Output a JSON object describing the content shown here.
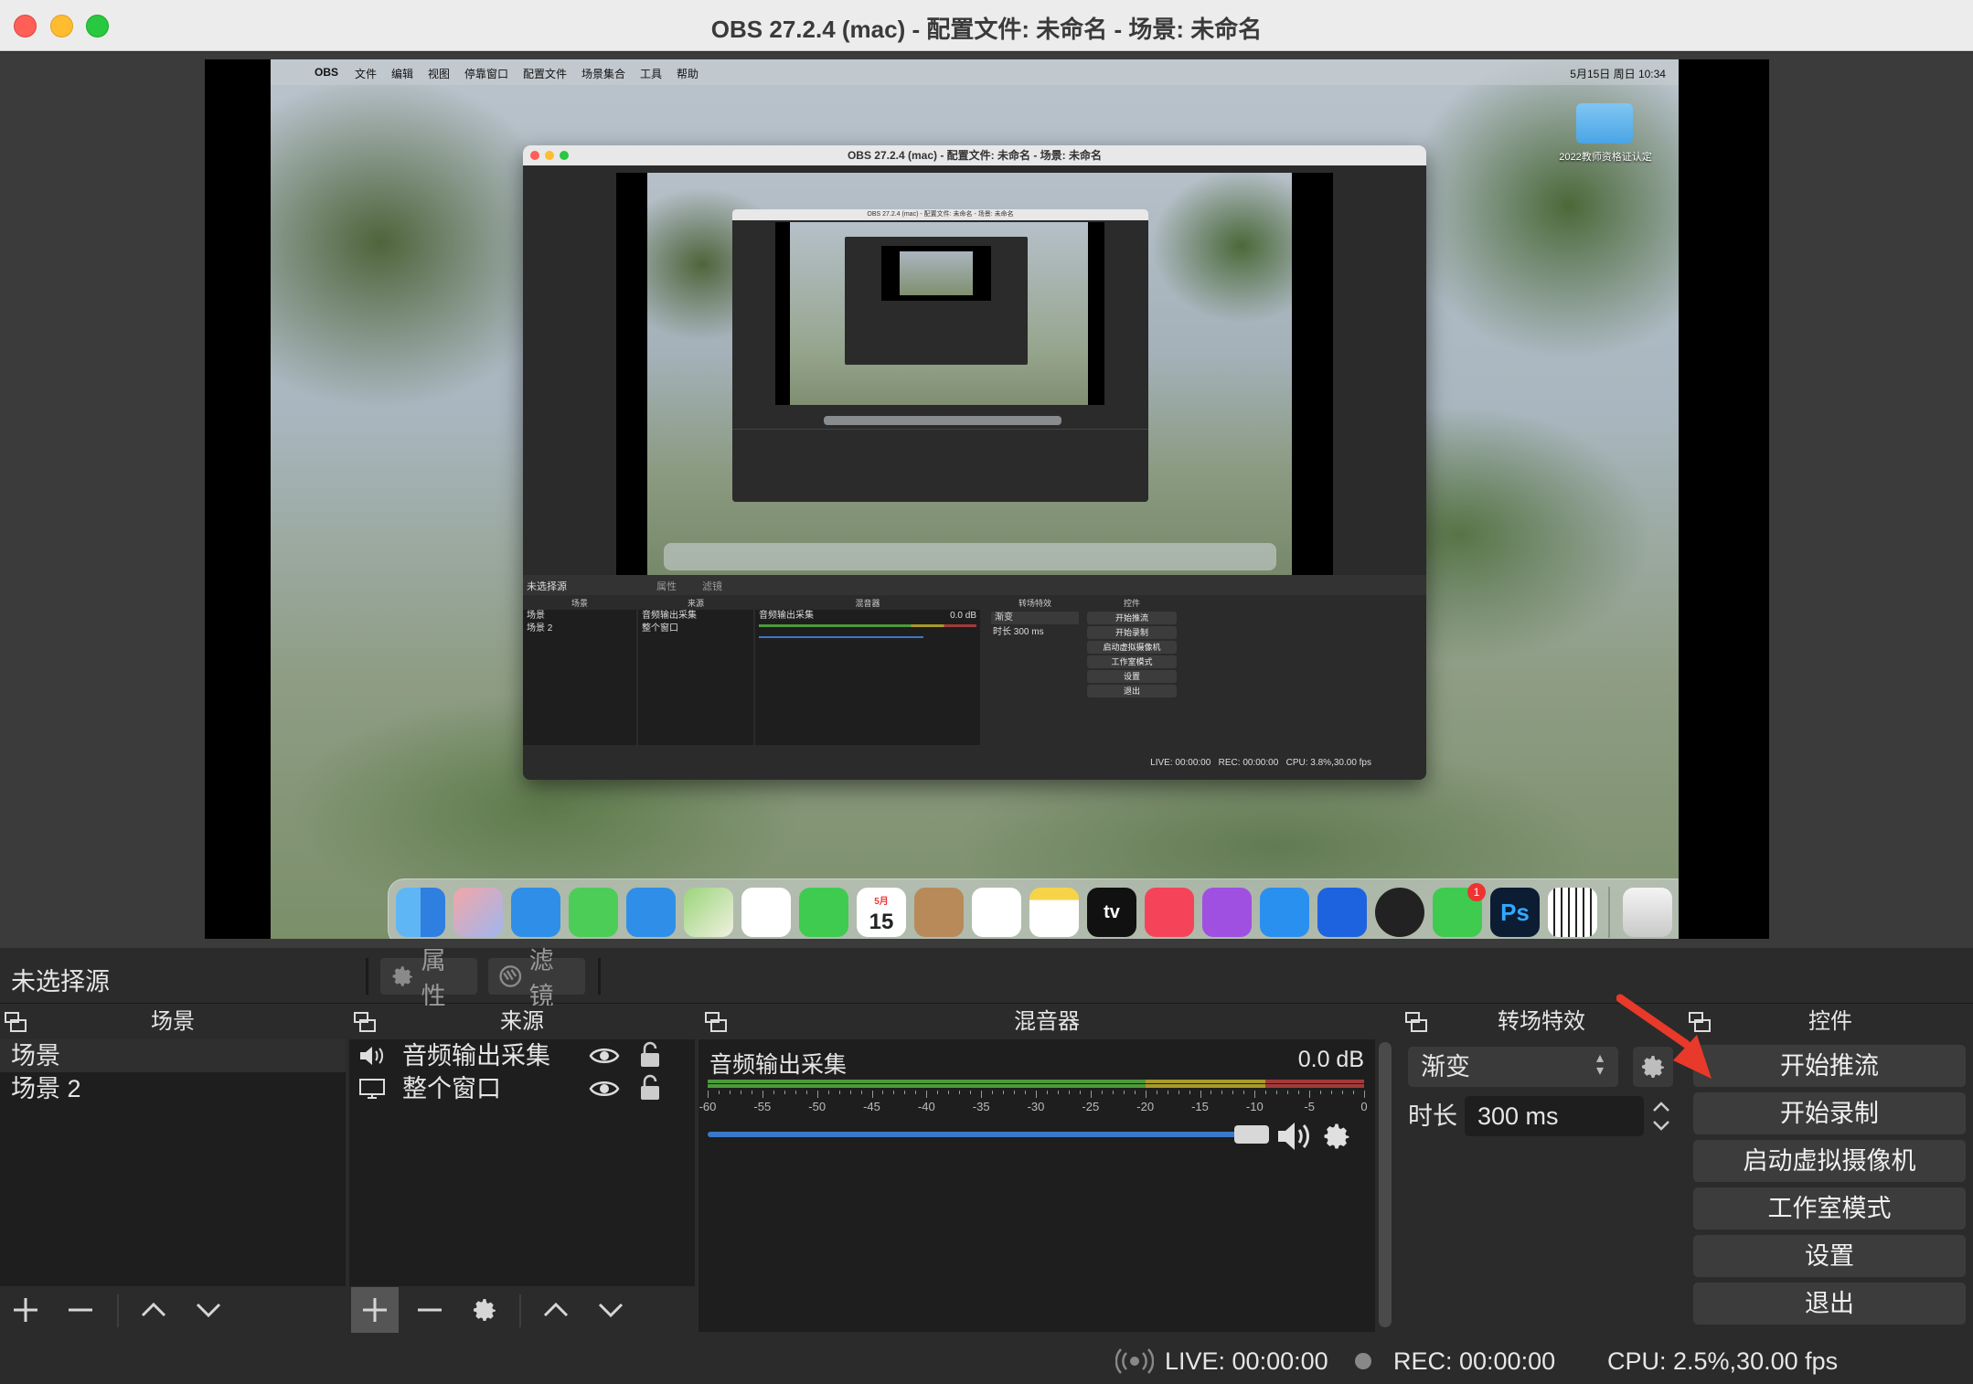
{
  "window": {
    "title": "OBS 27.2.4 (mac) - 配置文件: 未命名 - 场景: 未命名"
  },
  "desktop": {
    "menubar": [
      "OBS",
      "文件",
      "编辑",
      "视图",
      "停靠窗口",
      "配置文件",
      "场景集合",
      "工具",
      "帮助"
    ],
    "clock": "5月15日 周日 10:34",
    "folder_label": "2022教师资格证认定",
    "calendar_month": "5月",
    "calendar_day": "15",
    "messages_badge": "1",
    "appletv_label": "tv",
    "ps_label": "Ps"
  },
  "nested": {
    "title": "OBS 27.2.4 (mac) - 配置文件: 未命名 - 场景: 未命名",
    "no_source": "未选择源",
    "props": "属性",
    "filters": "滤镜",
    "headers": {
      "scenes": "场景",
      "sources": "来源",
      "mixer": "混音器",
      "transitions": "转场特效",
      "controls": "控件"
    },
    "scenes": [
      "场景",
      "场景 2"
    ],
    "sources": [
      "音频输出采集",
      "整个窗口"
    ],
    "mixer_name": "音频输出采集",
    "mixer_db": "0.0 dB",
    "transition": "渐变",
    "duration_label": "时长",
    "duration": "300 ms",
    "controls": [
      "开始推流",
      "开始录制",
      "启动虚拟摄像机",
      "工作室模式",
      "设置",
      "退出"
    ],
    "live": "LIVE: 00:00:00",
    "rec": "REC: 00:00:00",
    "cpu": "CPU: 3.8%,30.00 fps"
  },
  "source_bar": {
    "no_source": "未选择源",
    "properties": "属性",
    "filters": "滤镜"
  },
  "panels": {
    "scenes_title": "场景",
    "sources_title": "来源",
    "mixer_title": "混音器",
    "transitions_title": "转场特效",
    "controls_title": "控件"
  },
  "scenes": [
    {
      "name": "场景",
      "selected": true
    },
    {
      "name": "场景 2",
      "selected": false
    }
  ],
  "sources": [
    {
      "name": "音频输出采集",
      "icon": "speaker-icon"
    },
    {
      "name": "整个窗口",
      "icon": "monitor-icon"
    }
  ],
  "mixer": {
    "name": "音频输出采集",
    "db": "0.0 dB",
    "ticks": [
      "-60",
      "-55",
      "-50",
      "-45",
      "-40",
      "-35",
      "-30",
      "-25",
      "-20",
      "-15",
      "-10",
      "-5",
      "0"
    ],
    "volume": 1.0
  },
  "transitions": {
    "selected": "渐变",
    "duration_label": "时长",
    "duration_value": "300 ms"
  },
  "controls": {
    "start_streaming": "开始推流",
    "start_recording": "开始录制",
    "start_virtual_cam": "启动虚拟摄像机",
    "studio_mode": "工作室模式",
    "settings": "设置",
    "exit": "退出"
  },
  "status": {
    "live": "LIVE: 00:00:00",
    "rec": "REC: 00:00:00",
    "cpu": "CPU: 2.5%,30.00 fps"
  },
  "colors": {
    "meter_green": "#4c9a3a",
    "meter_yellow": "#a99a2a",
    "meter_red": "#a33a3a",
    "volume_blue": "#3a78c9",
    "annotation_arrow": "#e8392a"
  }
}
